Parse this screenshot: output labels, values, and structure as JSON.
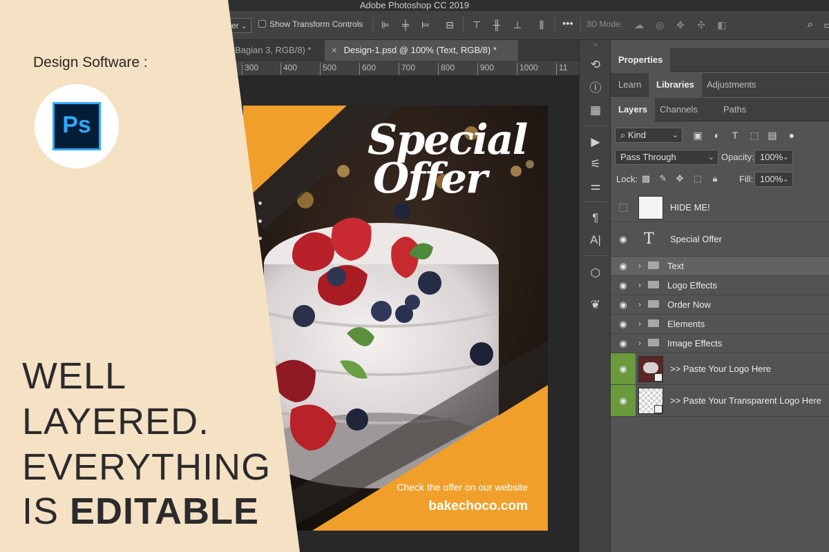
{
  "app": {
    "window_title": "Adobe Photoshop CC 2019"
  },
  "options_bar": {
    "partial_dropdown": "er",
    "show_transform_controls": "Show Transform Controls",
    "more": "•••",
    "mode_3d": "3D Mode:"
  },
  "document_tabs": [
    {
      "label": "Bagian 3, RGB/8) *"
    },
    {
      "label": "Design-1.psd @ 100% (Text, RGB/8) *",
      "close": "×"
    }
  ],
  "ruler": {
    "ticks": [
      "300",
      "400",
      "500",
      "600",
      "700",
      "800",
      "900",
      "1000",
      "11"
    ]
  },
  "tool_strip": {
    "collapse": "‹‹",
    "icons": [
      "history-icon",
      "info-icon",
      "grid-icon",
      "play-icon",
      "brushes-icon",
      "adjust-sliders-icon",
      "paragraph-icon",
      "character-icon",
      "cube-icon",
      "feather-icon"
    ]
  },
  "panels": {
    "properties_tab": "Properties",
    "group2_tabs": [
      "Learn",
      "Libraries",
      "Adjustments"
    ],
    "group3_tabs": [
      "Layers",
      "Channels",
      "Paths"
    ],
    "filter_kind": "Kind",
    "blend_mode": "Pass Through",
    "opacity_label": "Opacity:",
    "opacity_value": "100%",
    "lock_label": "Lock:",
    "fill_label": "Fill:",
    "fill_value": "100%"
  },
  "layers": [
    {
      "name": "HIDE ME!",
      "type": "image",
      "visible": false
    },
    {
      "name": "Special Offer",
      "type": "text",
      "visible": true
    },
    {
      "name": "Text",
      "type": "group",
      "visible": true,
      "selected": true
    },
    {
      "name": "Logo Effects",
      "type": "group",
      "visible": true
    },
    {
      "name": "Order Now",
      "type": "group",
      "visible": true
    },
    {
      "name": "Elements",
      "type": "group",
      "visible": true
    },
    {
      "name": "Image Effects",
      "type": "group",
      "visible": true
    },
    {
      "name": ">> Paste Your Logo Here",
      "type": "smart",
      "visible": true,
      "color": "#6a9a3c"
    },
    {
      "name": ">> Paste Your Transparent Logo Here",
      "type": "smart",
      "visible": true,
      "color": "#6a9a3c"
    }
  ],
  "poster": {
    "title_line1": "Special",
    "title_line2": "Offer",
    "caption": "Check the offer on our website",
    "url": "bakechoco.com",
    "accent": "#f0a02a"
  },
  "promo": {
    "heading": "Design Software :",
    "logo_text": "Ps",
    "line1": "WELL",
    "line2": "LAYERED.",
    "line3": "EVERYTHING",
    "line4_prefix": "IS ",
    "line4_bold": "EDITABLE",
    "bg_color": "#f5e1c4"
  }
}
